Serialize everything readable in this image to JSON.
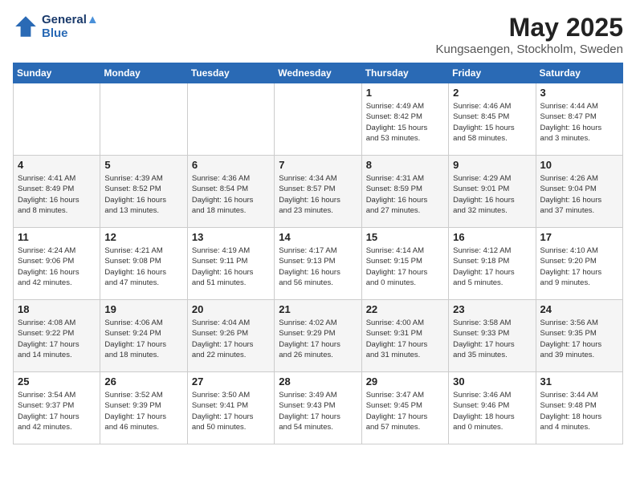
{
  "header": {
    "logo_line1": "General",
    "logo_line2": "Blue",
    "month_title": "May 2025",
    "location": "Kungsaengen, Stockholm, Sweden"
  },
  "weekdays": [
    "Sunday",
    "Monday",
    "Tuesday",
    "Wednesday",
    "Thursday",
    "Friday",
    "Saturday"
  ],
  "weeks": [
    [
      {
        "day": "",
        "info": ""
      },
      {
        "day": "",
        "info": ""
      },
      {
        "day": "",
        "info": ""
      },
      {
        "day": "",
        "info": ""
      },
      {
        "day": "1",
        "info": "Sunrise: 4:49 AM\nSunset: 8:42 PM\nDaylight: 15 hours\nand 53 minutes."
      },
      {
        "day": "2",
        "info": "Sunrise: 4:46 AM\nSunset: 8:45 PM\nDaylight: 15 hours\nand 58 minutes."
      },
      {
        "day": "3",
        "info": "Sunrise: 4:44 AM\nSunset: 8:47 PM\nDaylight: 16 hours\nand 3 minutes."
      }
    ],
    [
      {
        "day": "4",
        "info": "Sunrise: 4:41 AM\nSunset: 8:49 PM\nDaylight: 16 hours\nand 8 minutes."
      },
      {
        "day": "5",
        "info": "Sunrise: 4:39 AM\nSunset: 8:52 PM\nDaylight: 16 hours\nand 13 minutes."
      },
      {
        "day": "6",
        "info": "Sunrise: 4:36 AM\nSunset: 8:54 PM\nDaylight: 16 hours\nand 18 minutes."
      },
      {
        "day": "7",
        "info": "Sunrise: 4:34 AM\nSunset: 8:57 PM\nDaylight: 16 hours\nand 23 minutes."
      },
      {
        "day": "8",
        "info": "Sunrise: 4:31 AM\nSunset: 8:59 PM\nDaylight: 16 hours\nand 27 minutes."
      },
      {
        "day": "9",
        "info": "Sunrise: 4:29 AM\nSunset: 9:01 PM\nDaylight: 16 hours\nand 32 minutes."
      },
      {
        "day": "10",
        "info": "Sunrise: 4:26 AM\nSunset: 9:04 PM\nDaylight: 16 hours\nand 37 minutes."
      }
    ],
    [
      {
        "day": "11",
        "info": "Sunrise: 4:24 AM\nSunset: 9:06 PM\nDaylight: 16 hours\nand 42 minutes."
      },
      {
        "day": "12",
        "info": "Sunrise: 4:21 AM\nSunset: 9:08 PM\nDaylight: 16 hours\nand 47 minutes."
      },
      {
        "day": "13",
        "info": "Sunrise: 4:19 AM\nSunset: 9:11 PM\nDaylight: 16 hours\nand 51 minutes."
      },
      {
        "day": "14",
        "info": "Sunrise: 4:17 AM\nSunset: 9:13 PM\nDaylight: 16 hours\nand 56 minutes."
      },
      {
        "day": "15",
        "info": "Sunrise: 4:14 AM\nSunset: 9:15 PM\nDaylight: 17 hours\nand 0 minutes."
      },
      {
        "day": "16",
        "info": "Sunrise: 4:12 AM\nSunset: 9:18 PM\nDaylight: 17 hours\nand 5 minutes."
      },
      {
        "day": "17",
        "info": "Sunrise: 4:10 AM\nSunset: 9:20 PM\nDaylight: 17 hours\nand 9 minutes."
      }
    ],
    [
      {
        "day": "18",
        "info": "Sunrise: 4:08 AM\nSunset: 9:22 PM\nDaylight: 17 hours\nand 14 minutes."
      },
      {
        "day": "19",
        "info": "Sunrise: 4:06 AM\nSunset: 9:24 PM\nDaylight: 17 hours\nand 18 minutes."
      },
      {
        "day": "20",
        "info": "Sunrise: 4:04 AM\nSunset: 9:26 PM\nDaylight: 17 hours\nand 22 minutes."
      },
      {
        "day": "21",
        "info": "Sunrise: 4:02 AM\nSunset: 9:29 PM\nDaylight: 17 hours\nand 26 minutes."
      },
      {
        "day": "22",
        "info": "Sunrise: 4:00 AM\nSunset: 9:31 PM\nDaylight: 17 hours\nand 31 minutes."
      },
      {
        "day": "23",
        "info": "Sunrise: 3:58 AM\nSunset: 9:33 PM\nDaylight: 17 hours\nand 35 minutes."
      },
      {
        "day": "24",
        "info": "Sunrise: 3:56 AM\nSunset: 9:35 PM\nDaylight: 17 hours\nand 39 minutes."
      }
    ],
    [
      {
        "day": "25",
        "info": "Sunrise: 3:54 AM\nSunset: 9:37 PM\nDaylight: 17 hours\nand 42 minutes."
      },
      {
        "day": "26",
        "info": "Sunrise: 3:52 AM\nSunset: 9:39 PM\nDaylight: 17 hours\nand 46 minutes."
      },
      {
        "day": "27",
        "info": "Sunrise: 3:50 AM\nSunset: 9:41 PM\nDaylight: 17 hours\nand 50 minutes."
      },
      {
        "day": "28",
        "info": "Sunrise: 3:49 AM\nSunset: 9:43 PM\nDaylight: 17 hours\nand 54 minutes."
      },
      {
        "day": "29",
        "info": "Sunrise: 3:47 AM\nSunset: 9:45 PM\nDaylight: 17 hours\nand 57 minutes."
      },
      {
        "day": "30",
        "info": "Sunrise: 3:46 AM\nSunset: 9:46 PM\nDaylight: 18 hours\nand 0 minutes."
      },
      {
        "day": "31",
        "info": "Sunrise: 3:44 AM\nSunset: 9:48 PM\nDaylight: 18 hours\nand 4 minutes."
      }
    ]
  ]
}
